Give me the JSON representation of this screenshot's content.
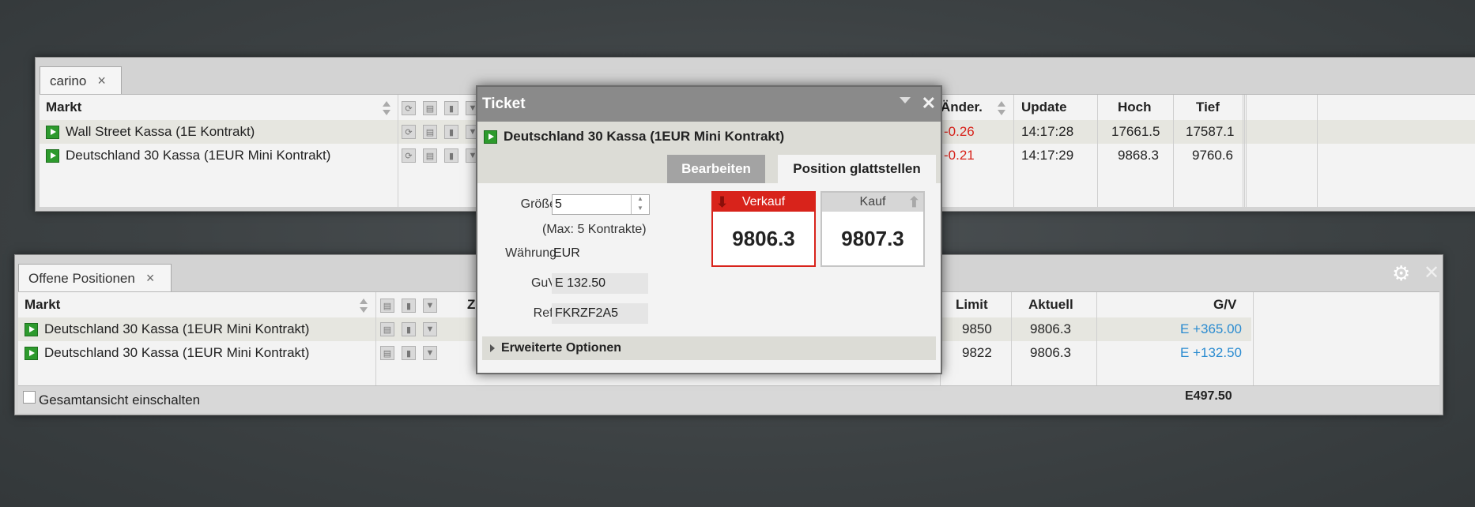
{
  "markets_panel": {
    "tab_label": "carino",
    "tab_close": "×",
    "headers": {
      "markt": "Markt",
      "aender": "Änder.",
      "update": "Update",
      "hoch": "Hoch",
      "tief": "Tief"
    },
    "rows": [
      {
        "name": "Wall Street Kassa (1E Kontrakt)",
        "change": "-0.26",
        "update": "14:17:28",
        "hoch": "17661.5",
        "tief": "17587.1"
      },
      {
        "name": "Deutschland 30 Kassa (1EUR Mini Kontrakt)",
        "change": "-0.21",
        "update": "14:17:29",
        "hoch": "9868.3",
        "tief": "9760.6"
      }
    ]
  },
  "positions_panel": {
    "tab_label": "Offene Positionen",
    "tab_close": "×",
    "headers": {
      "markt": "Markt",
      "z": "Z",
      "limit": "Limit",
      "aktuell": "Aktuell",
      "gv": "G/V"
    },
    "rows": [
      {
        "name": "Deutschland 30 Kassa (1EUR Mini Kontrakt)",
        "limit": "9850",
        "aktuell": "9806.3",
        "gv": "E +365.00"
      },
      {
        "name": "Deutschland 30 Kassa (1EUR Mini Kontrakt)",
        "limit": "9822",
        "aktuell": "9806.3",
        "gv": "E +132.50"
      }
    ],
    "footer": {
      "checkbox_label": "Gesamtansicht einschalten",
      "total": "E497.50"
    }
  },
  "ticket": {
    "title": "Ticket",
    "instrument": "Deutschland 30 Kassa (1EUR Mini Kontrakt)",
    "tab_edit": "Bearbeiten",
    "tab_close_position": "Position glattstellen",
    "size_label": "Größe",
    "size_value": "5",
    "max_note": "(Max: 5 Kontrakte)",
    "currency_label": "Währung",
    "currency_value": "EUR",
    "pnl_label": "GuV",
    "pnl_value": "E 132.50",
    "ref_label": "Ref.",
    "ref_value": "FKRZF2A5",
    "sell_label": "Verkauf",
    "sell_price": "9806.3",
    "buy_label": "Kauf",
    "buy_price": "9807.3",
    "advanced_options": "Erweiterte Optionen"
  },
  "colors": {
    "sell_red": "#d8231b",
    "gain_blue": "#2a8bd0",
    "play_green": "#2d9a2d"
  }
}
